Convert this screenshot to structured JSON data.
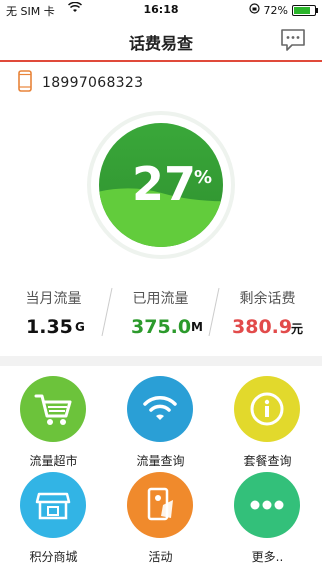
{
  "status_bar": {
    "carrier": "无 SIM 卡",
    "time": "16:18",
    "battery": "72%"
  },
  "nav": {
    "title": "话费易查"
  },
  "phone": {
    "number": "18997068323"
  },
  "usage": {
    "percent": "27",
    "unit": "%",
    "fill_fraction": 0.27
  },
  "stats": [
    {
      "label": "当月流量",
      "value": "1.35",
      "unit": "G",
      "color": "#111111"
    },
    {
      "label": "已用流量",
      "value": "375.0",
      "unit": "M",
      "color": "#2c9a2c"
    },
    {
      "label": "剩余话费",
      "value": "380.9",
      "unit": "元",
      "color": "#e24b4b"
    }
  ],
  "grid": [
    {
      "label": "流量超市",
      "icon": "cart-icon",
      "color": "#6cc33b"
    },
    {
      "label": "流量查询",
      "icon": "wifi-icon",
      "color": "#2a9fd6"
    },
    {
      "label": "套餐查询",
      "icon": "info-icon",
      "color": "#e2d92c"
    },
    {
      "label": "积分商城",
      "icon": "store-icon",
      "color": "#32b4e5"
    },
    {
      "label": "活动",
      "icon": "activity-icon",
      "color": "#f08a2c"
    },
    {
      "label": "更多..",
      "icon": "more-icon",
      "color": "#33c07a"
    }
  ]
}
